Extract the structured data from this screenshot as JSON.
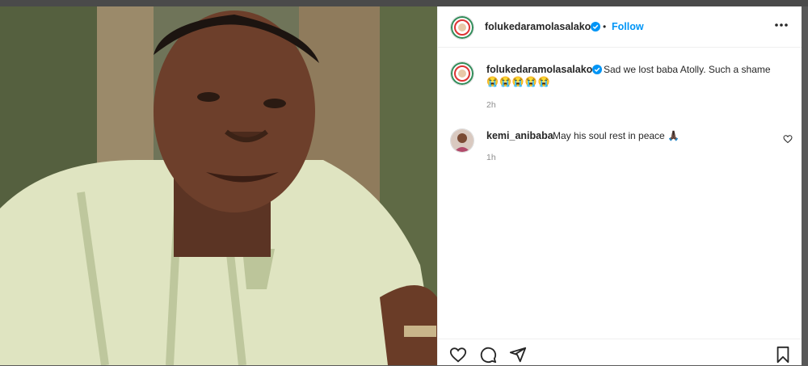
{
  "post": {
    "author": "folukedaramolasalako",
    "separator": "•",
    "follow_label": "Follow",
    "caption": "Sad we lost baba Atolly. Such a shame",
    "caption_emojis": "😭😭😭😭😭",
    "caption_time": "2h"
  },
  "comments": [
    {
      "author": "kemi_anibaba",
      "text": "May his soul rest in peace 🙏🏿",
      "time": "1h"
    }
  ],
  "colors": {
    "accent": "#0095f6",
    "verified": "#0095f6",
    "text": "#262626",
    "muted": "#8e8e8e"
  },
  "icons": {
    "more": "more-options-icon",
    "verified": "verified-badge-icon",
    "like": "heart-icon",
    "comment": "comment-icon",
    "share": "share-icon",
    "save": "bookmark-icon"
  }
}
